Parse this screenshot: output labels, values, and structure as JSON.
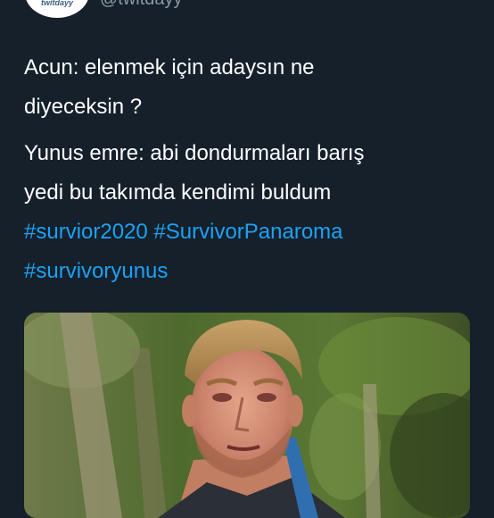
{
  "tweet": {
    "avatar_text": "twitdayy",
    "handle": "@twitdayy",
    "paragraphs": [
      {
        "lines": [
          "Acun: elenmek için adaysın ne",
          "diyeceksin ?"
        ]
      },
      {
        "lines": [
          "Yunus emre: abi dondurmaları barış",
          "yedi bu takımda kendimi buldum"
        ]
      }
    ],
    "hashtags": [
      "#survior2020",
      "#SurvivorPanaroma",
      "#survivoryunus"
    ],
    "link_color": "#1da1f2"
  },
  "media": {
    "description_icon": "photo-image"
  }
}
